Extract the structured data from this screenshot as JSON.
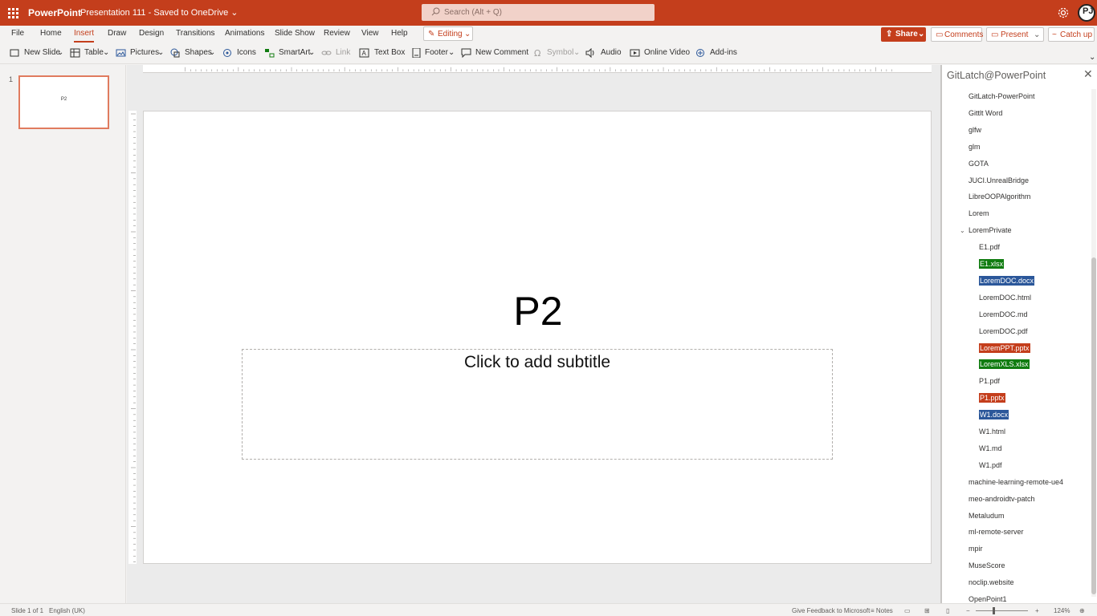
{
  "app": {
    "name": "PowerPoint",
    "doc_title": "Presentation 111 - Saved to OneDrive",
    "search_placeholder": "Search (Alt + Q)",
    "accent": "#c43e1c"
  },
  "menu": {
    "tabs": [
      "File",
      "Home",
      "Insert",
      "Draw",
      "Design",
      "Transitions",
      "Animations",
      "Slide Show",
      "Review",
      "View",
      "Help"
    ],
    "active_tab": "Insert",
    "editing": "Editing",
    "share": "Share",
    "comments": "Comments",
    "present": "Present",
    "catch_up": "Catch up"
  },
  "toolbar": {
    "new_slide": "New Slide",
    "table": "Table",
    "pictures": "Pictures",
    "shapes": "Shapes",
    "icons": "Icons",
    "smartart": "SmartArt",
    "link": "Link",
    "text_box": "Text Box",
    "footer": "Footer",
    "new_comment": "New Comment",
    "symbol": "Symbol",
    "audio": "Audio",
    "online_video": "Online Video",
    "add_ins": "Add-ins"
  },
  "thumbnails": {
    "number": "1",
    "label": "P2"
  },
  "slide": {
    "title": "P2",
    "subtitle_placeholder": "Click to add subtitle"
  },
  "sidepane": {
    "title": "GitLatch@PowerPoint",
    "items": [
      {
        "label": "GitLatch-PowerPoint",
        "level": 1,
        "hl": ""
      },
      {
        "label": "Gittlt Word",
        "level": 1,
        "hl": ""
      },
      {
        "label": "glfw",
        "level": 1,
        "hl": ""
      },
      {
        "label": "glm",
        "level": 1,
        "hl": ""
      },
      {
        "label": "GOTA",
        "level": 1,
        "hl": ""
      },
      {
        "label": "JUCI.UnrealBridge",
        "level": 1,
        "hl": ""
      },
      {
        "label": "LibreOOPAlgorithm",
        "level": 1,
        "hl": ""
      },
      {
        "label": "Lorem",
        "level": 1,
        "hl": ""
      },
      {
        "label": "LoremPrivate",
        "level": 1,
        "hl": "",
        "expanded": true
      },
      {
        "label": "E1.pdf",
        "level": 2,
        "hl": ""
      },
      {
        "label": "E1.xlsx",
        "level": 2,
        "hl": "green"
      },
      {
        "label": "LoremDOC.docx",
        "level": 2,
        "hl": "blue"
      },
      {
        "label": "LoremDOC.html",
        "level": 2,
        "hl": ""
      },
      {
        "label": "LoremDOC.md",
        "level": 2,
        "hl": ""
      },
      {
        "label": "LoremDOC.pdf",
        "level": 2,
        "hl": ""
      },
      {
        "label": "LoremPPT.pptx",
        "level": 2,
        "hl": "red"
      },
      {
        "label": "LoremXLS.xlsx",
        "level": 2,
        "hl": "green"
      },
      {
        "label": "P1.pdf",
        "level": 2,
        "hl": ""
      },
      {
        "label": "P1.pptx",
        "level": 2,
        "hl": "red"
      },
      {
        "label": "W1.docx",
        "level": 2,
        "hl": "blue"
      },
      {
        "label": "W1.html",
        "level": 2,
        "hl": ""
      },
      {
        "label": "W1.md",
        "level": 2,
        "hl": ""
      },
      {
        "label": "W1.pdf",
        "level": 2,
        "hl": ""
      },
      {
        "label": "machine-learning-remote-ue4",
        "level": 1,
        "hl": ""
      },
      {
        "label": "meo-androidtv-patch",
        "level": 1,
        "hl": ""
      },
      {
        "label": "Metaludum",
        "level": 1,
        "hl": ""
      },
      {
        "label": "ml-remote-server",
        "level": 1,
        "hl": ""
      },
      {
        "label": "mpir",
        "level": 1,
        "hl": ""
      },
      {
        "label": "MuseScore",
        "level": 1,
        "hl": ""
      },
      {
        "label": "noclip.website",
        "level": 1,
        "hl": ""
      },
      {
        "label": "OpenPoint1",
        "level": 1,
        "hl": ""
      }
    ]
  },
  "status": {
    "slide_info": "Slide 1 of 1",
    "language": "English (UK)",
    "feedback": "Give Feedback to Microsoft",
    "notes": "Notes",
    "zoom": "124%"
  }
}
